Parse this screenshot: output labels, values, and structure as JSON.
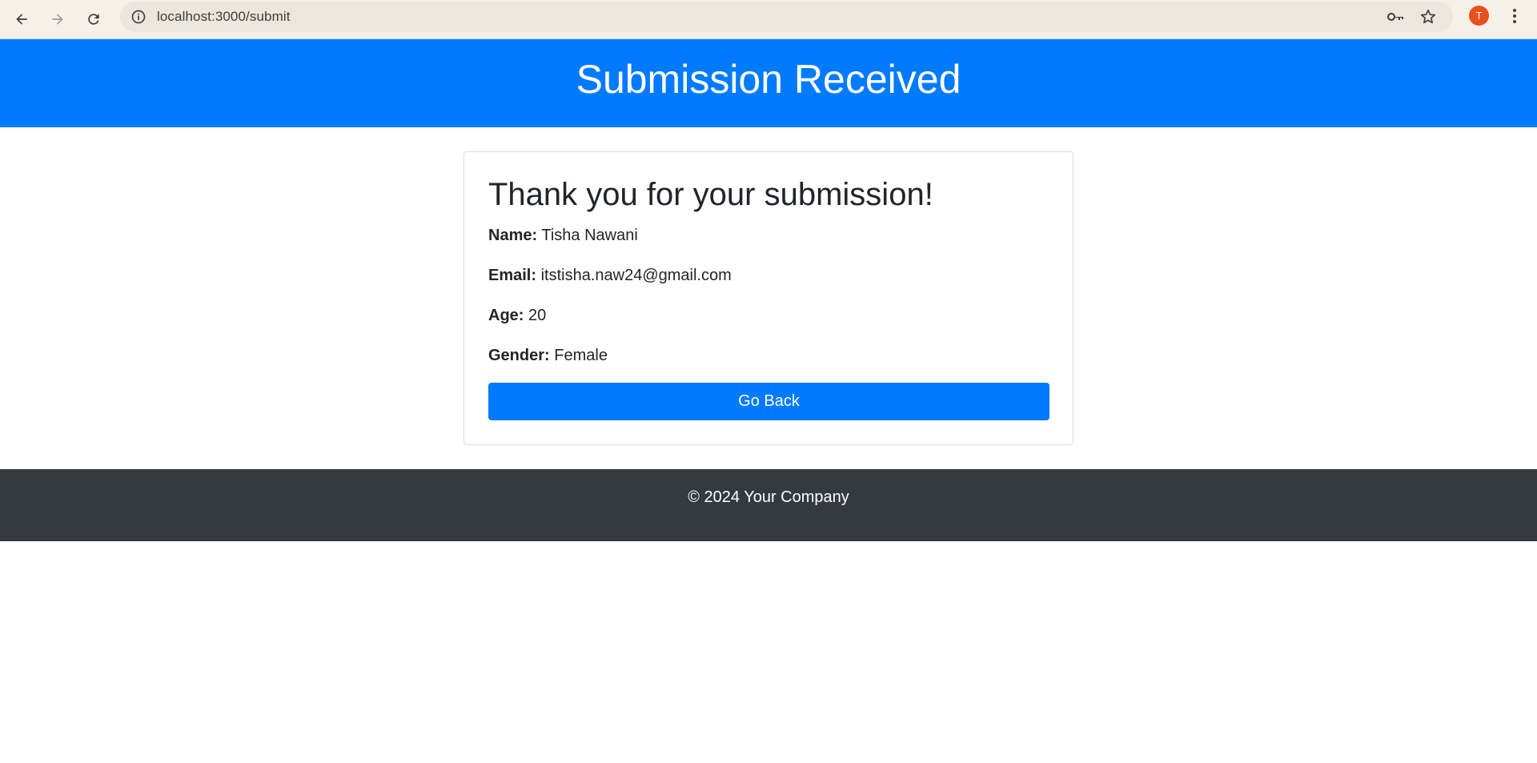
{
  "browser": {
    "url": "localhost:3000/submit",
    "profile_initial": "T",
    "icons": [
      "back-arrow-icon",
      "forward-arrow-icon",
      "reload-icon",
      "site-info-icon",
      "password-key-icon",
      "bookmark-star-icon",
      "more-menu-icon"
    ]
  },
  "header": {
    "title": "Submission Received"
  },
  "card": {
    "heading": "Thank you for your submission!",
    "fields": [
      {
        "label": "Name:",
        "value": "Tisha Nawani"
      },
      {
        "label": "Email:",
        "value": "itstisha.naw24@gmail.com"
      },
      {
        "label": "Age:",
        "value": "20"
      },
      {
        "label": "Gender:",
        "value": "Female"
      }
    ],
    "button_label": "Go Back"
  },
  "footer": {
    "text": "© 2024 Your Company"
  },
  "colors": {
    "primary": "#007bff",
    "footer_bg": "#343a40",
    "avatar": "#e8501e"
  }
}
